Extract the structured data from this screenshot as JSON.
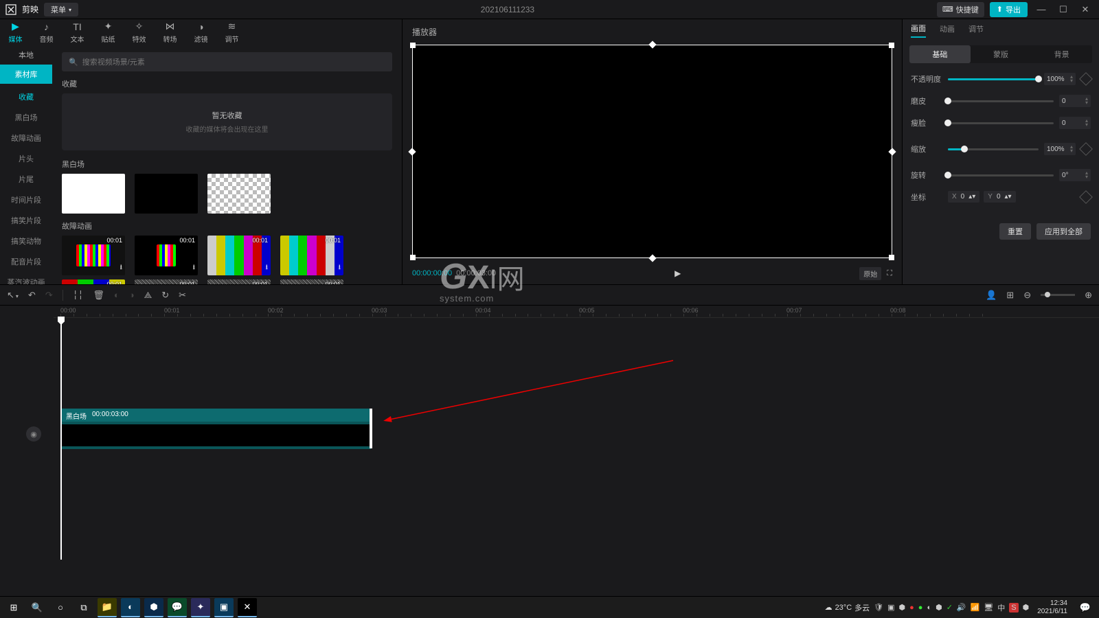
{
  "app": {
    "name": "剪映",
    "menu": "菜单"
  },
  "title": "202106111233",
  "shortcut": "快捷键",
  "export": "导出",
  "topTabs": [
    {
      "label": "媒体",
      "icon": "▶"
    },
    {
      "label": "音频",
      "icon": "♪"
    },
    {
      "label": "文本",
      "icon": "TI"
    },
    {
      "label": "贴纸",
      "icon": "✦"
    },
    {
      "label": "特效",
      "icon": "✧"
    },
    {
      "label": "转场",
      "icon": "⋈"
    },
    {
      "label": "滤镜",
      "icon": "◑"
    },
    {
      "label": "调节",
      "icon": "≋"
    }
  ],
  "sideTabs": {
    "local": "本地",
    "library": "素材库"
  },
  "categories": [
    "收藏",
    "黑白场",
    "故障动画",
    "片头",
    "片尾",
    "时间片段",
    "搞笑片段",
    "搞笑动物",
    "配音片段",
    "蒸汽波动画"
  ],
  "search": {
    "placeholder": "搜索视频场景/元素"
  },
  "sections": {
    "favorites": "收藏",
    "empty_title": "暂无收藏",
    "empty_sub": "收藏的媒体将会出现在这里",
    "blackwhite": "黑白场",
    "glitch": "故障动画"
  },
  "clipDur": "00:01",
  "player": {
    "title": "播放器",
    "current": "00:00:00:00",
    "total": "00:00:03:00",
    "ratio": "原始"
  },
  "inspector": {
    "tabs": [
      "画面",
      "动画",
      "调节"
    ],
    "subtabs": [
      "基础",
      "蒙版",
      "背景"
    ],
    "opacity_label": "不透明度",
    "opacity_val": "100%",
    "smooth_label": "磨皮",
    "smooth_val": "0",
    "thin_label": "瘦脸",
    "thin_val": "0",
    "scale_label": "缩放",
    "scale_val": "100%",
    "rotate_label": "旋转",
    "rotate_val": "0°",
    "coord_label": "坐标",
    "x_label": "X",
    "x_val": "0",
    "y_label": "Y",
    "y_val": "0",
    "reset": "重置",
    "apply_all": "应用到全部"
  },
  "timeline": {
    "ticks": [
      "00:00",
      "00:01",
      "00:02",
      "00:03",
      "00:04",
      "00:05",
      "00:06",
      "00:07",
      "00:08"
    ],
    "clip_name": "黑白场",
    "clip_dur": "00:00:03:00"
  },
  "taskbar": {
    "weather_temp": "23°C",
    "weather_desc": "多云",
    "time": "12:34",
    "date": "2021/6/11",
    "ime": "中"
  }
}
